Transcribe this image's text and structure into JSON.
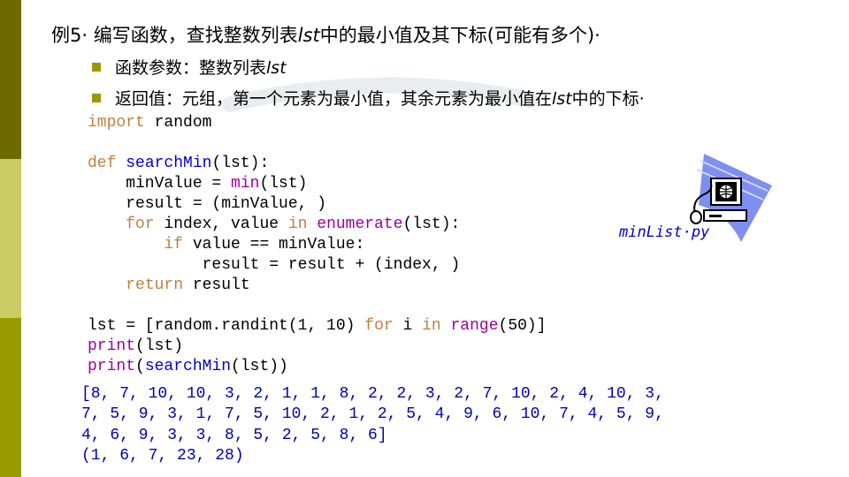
{
  "slide": {
    "title_prefix": "例5",
    "title_main": "编写函数，查找整数列表",
    "title_lst": "lst",
    "title_suffix": "中的最小值及其下标(可能有多个)·",
    "bullets": [
      {
        "label": "函数参数：",
        "text": "整数列表",
        "var": "lst",
        "tail": ""
      },
      {
        "label": "返回值：",
        "text": "元组，第一个元素为最小值，其余元素为最小值在",
        "var": "lst",
        "tail": "中的下标·"
      }
    ],
    "code_lines": [
      "import random",
      "",
      "def searchMin(lst):",
      "    minValue = min(lst)",
      "    result = (minValue, )",
      "    for index, value in enumerate(lst):",
      "        if value == minValue:",
      "            result = result + (index, )",
      "    return result",
      "",
      "lst = [random.randint(1, 10) for i in range(50)]",
      "print(lst)",
      "print(searchMin(lst))"
    ],
    "output_lines": [
      "[8, 7, 10, 10, 3, 2, 1, 1, 8, 2, 2, 3, 2, 7, 10, 2, 4, 10, 3,",
      "7, 5, 9, 3, 1, 7, 5, 10, 2, 1, 2, 5, 4, 9, 6, 10, 7, 4, 5, 9,",
      "4, 6, 9, 3, 3, 8, 5, 2, 5, 8, 6]",
      "(1, 6, 7, 23, 28)"
    ],
    "file_label": "minList·py",
    "icon": "computer-globe-icon",
    "colors": {
      "keyword": "#c08040",
      "builtin": "#a000a0",
      "function": "#0000cc",
      "output": "#0000aa",
      "accent": "#999900"
    }
  }
}
